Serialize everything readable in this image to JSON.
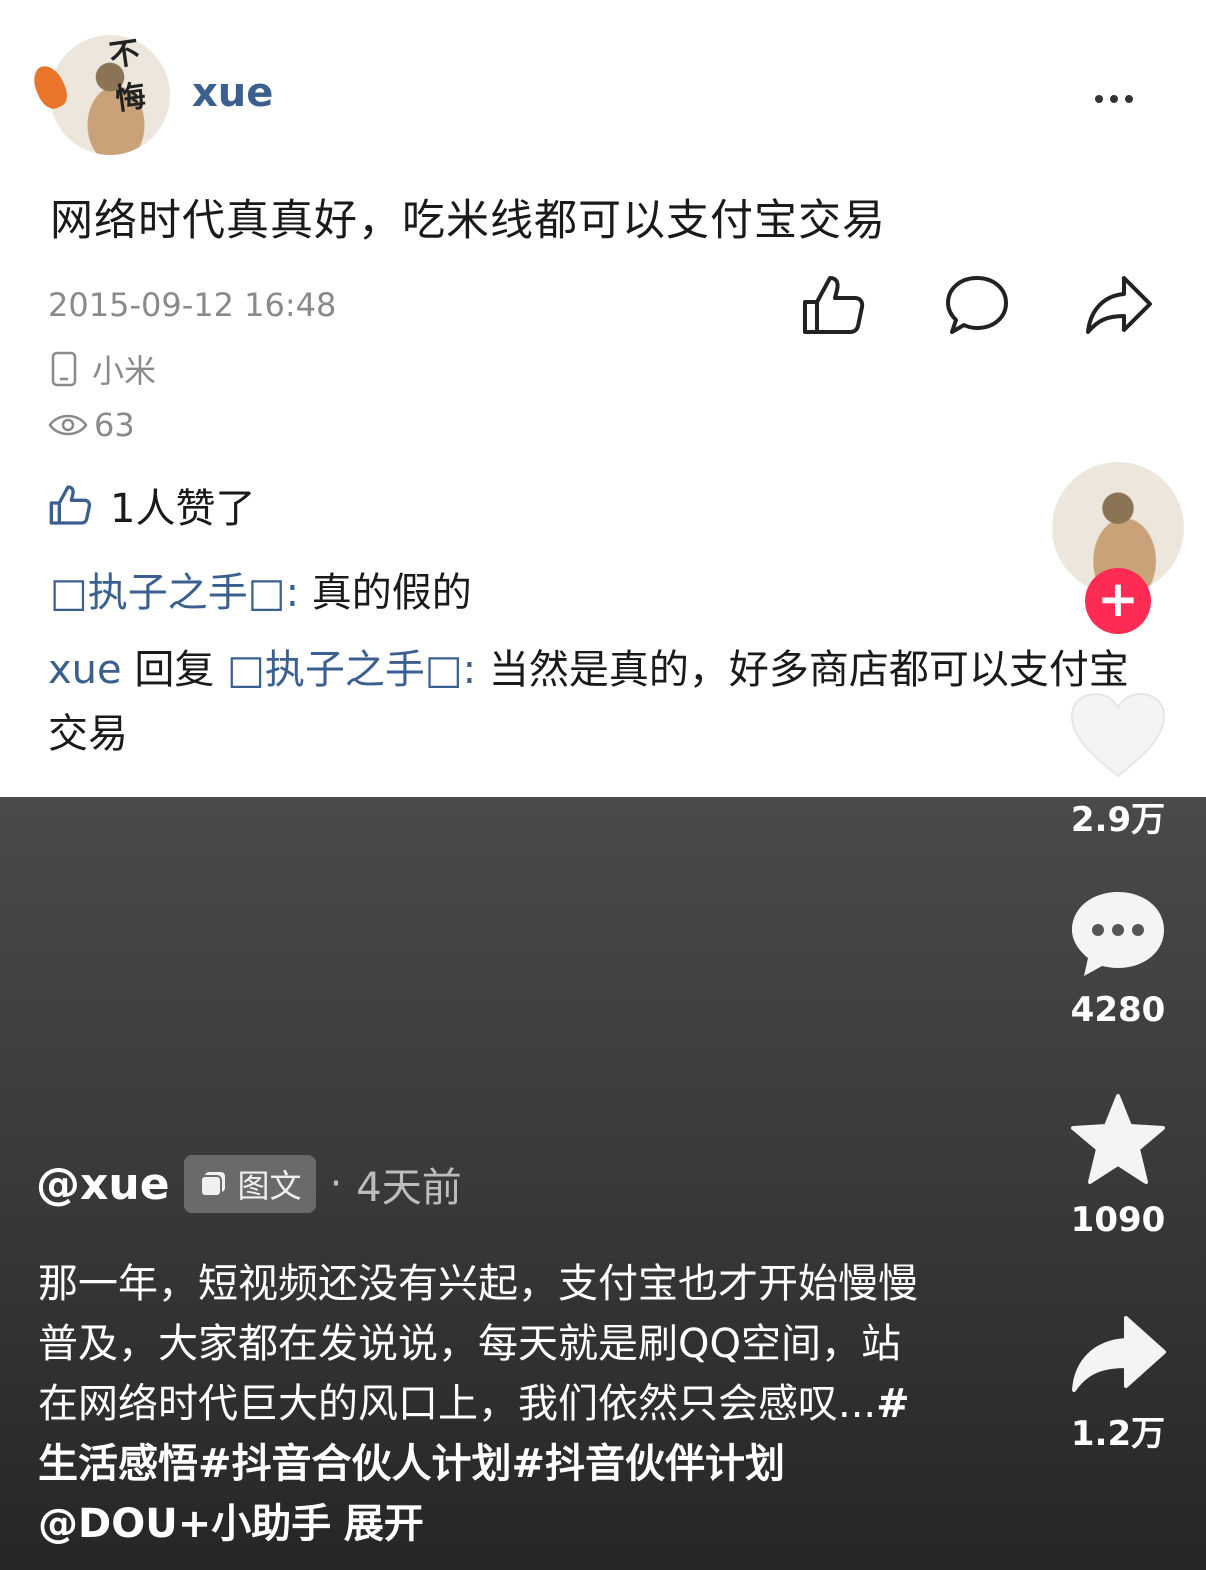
{
  "post": {
    "username": "xue",
    "avatar_text": "不悔",
    "text": "网络时代真真好，吃米线都可以支付宝交易",
    "timestamp": "2015-09-12 16:48",
    "device": "小米",
    "views": "63",
    "likes_text": "1人赞了",
    "comments": [
      {
        "author": "□执子之手□",
        "sep": ":",
        "text": "真的假的"
      },
      {
        "author": "xue",
        "reply_word": "回复",
        "target": "□执子之手□",
        "sep": ":",
        "text": "当然是真的，好多商店都可以支付宝交易"
      }
    ]
  },
  "video": {
    "author": "@xue",
    "tag_label": "图文",
    "dot": "·",
    "time_ago": "4天前",
    "caption": "那一年，短视频还没有兴起，支付宝也才开始慢慢普及，大家都在发说说，每天就是刷QQ空间，站在网络时代巨大的风口上，我们依然只会感叹...",
    "hashtags": "#生活感悟#抖音合伙人计划#抖音伙伴计划 @DOU+小助手",
    "expand_label": "展开"
  },
  "side": {
    "follow_symbol": "+",
    "likes": "2.9万",
    "comments": "4280",
    "favorites": "1090",
    "shares": "1.2万"
  },
  "colors": {
    "link_blue": "#3b5f8f",
    "accent_red": "#fe2c55",
    "meta_gray": "#8a8a8a"
  }
}
